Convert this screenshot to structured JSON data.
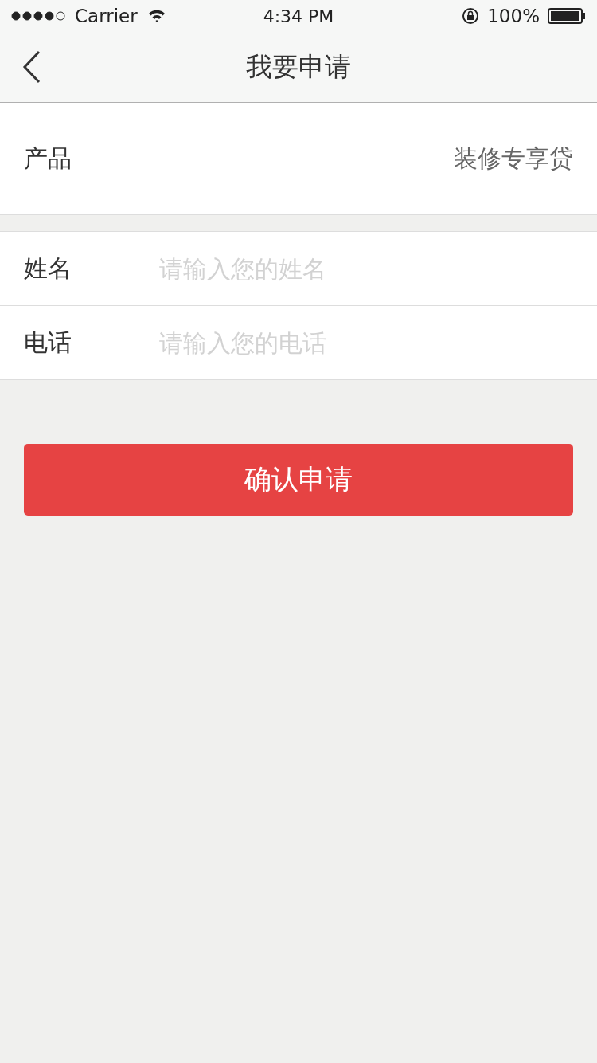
{
  "status_bar": {
    "carrier": "Carrier",
    "time": "4:34 PM",
    "battery": "100%"
  },
  "nav": {
    "title": "我要申请"
  },
  "product": {
    "label": "产品",
    "value": "装修专享贷"
  },
  "fields": [
    {
      "label": "姓名",
      "placeholder": "请输入您的姓名"
    },
    {
      "label": "电话",
      "placeholder": "请输入您的电话"
    }
  ],
  "submit": "确认申请"
}
